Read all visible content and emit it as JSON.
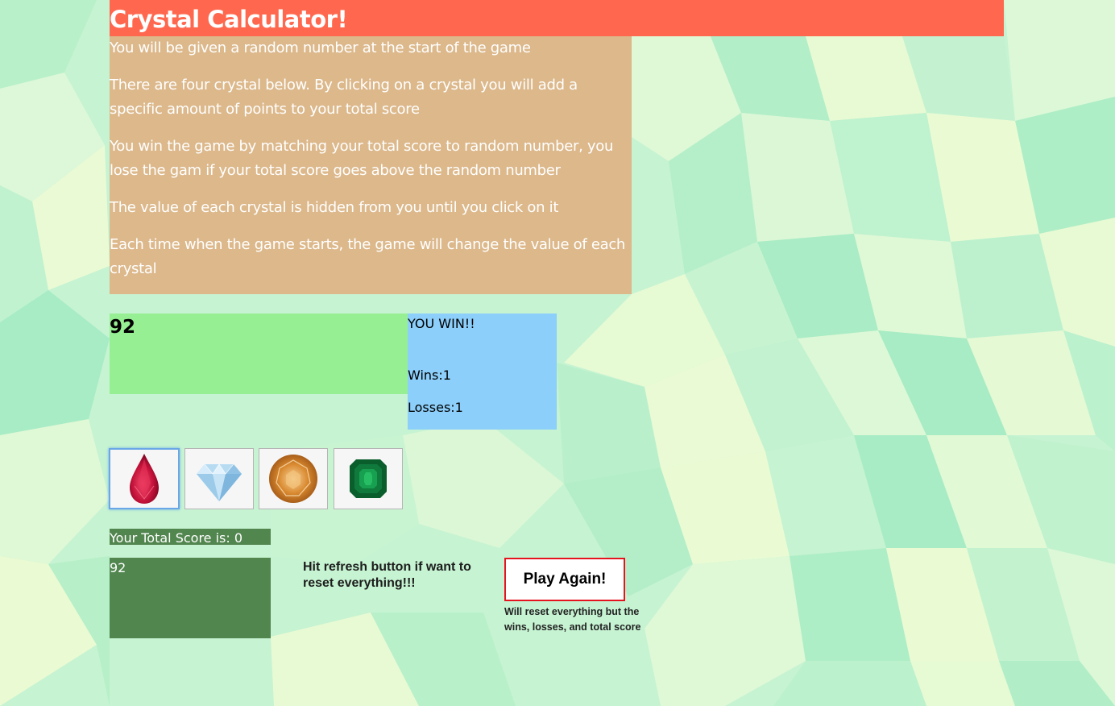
{
  "header": {
    "title": "Crystal Calculator!"
  },
  "instructions": [
    "You will be given a random number at the start of the game",
    "There are four crystal below. By clicking on a crystal you will add a specific amount of points to your total score",
    "You win the game by matching your total score to random number, you lose the gam if your total score goes above the random number",
    "The value of each crystal is hidden from you until you click on it",
    "Each time when the game starts, the game will change the value of each crystal"
  ],
  "game": {
    "random_number": "92",
    "result_message": "YOU WIN!!",
    "wins_text": "Wins:1",
    "losses_text": "Losses:1",
    "total_score_label": "Your Total Score is: 0",
    "score_value": "92"
  },
  "crystals": [
    {
      "name": "red-ruby-crystal-icon",
      "color": "#c4123a"
    },
    {
      "name": "blue-diamond-crystal-icon",
      "color": "#a9d4ee"
    },
    {
      "name": "orange-topaz-crystal-icon",
      "color": "#d9892f"
    },
    {
      "name": "green-emerald-crystal-icon",
      "color": "#0f7a3c"
    }
  ],
  "controls": {
    "refresh_note": "Hit refresh button if want to reset everything!!!",
    "play_again_label": "Play Again!",
    "play_again_note": "Will reset everything but the wins, losses, and total score"
  },
  "colors": {
    "title_bg": "#ff684e",
    "instructions_bg": "#dcb88b",
    "random_box_bg": "#96ef93",
    "status_box_bg": "#8ccffa",
    "score_bg": "#52864f",
    "play_again_border": "#e5141e"
  }
}
